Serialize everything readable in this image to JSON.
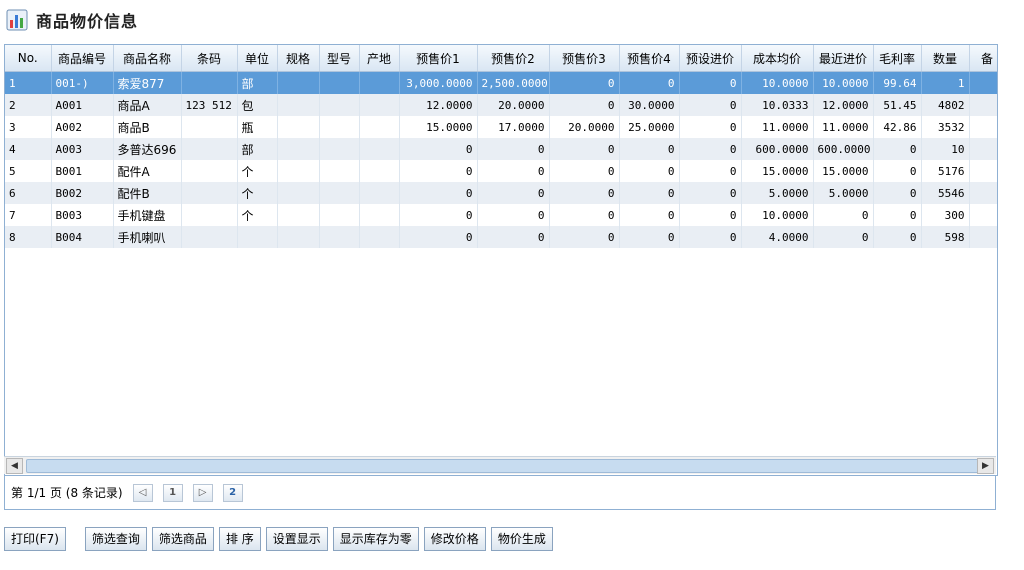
{
  "page": {
    "title": "商品物价信息"
  },
  "columns": [
    "No.",
    "商品编号",
    "商品名称",
    "条码",
    "单位",
    "规格",
    "型号",
    "产地",
    "预售价1",
    "预售价2",
    "预售价3",
    "预售价4",
    "预设进价",
    "成本均价",
    "最近进价",
    "毛利率",
    "数量",
    "备"
  ],
  "rows": [
    [
      "1",
      "001-)",
      "索爱877",
      "",
      "部",
      "",
      "",
      "",
      "3,000.0000",
      "2,500.0000",
      "0",
      "0",
      "0",
      "10.0000",
      "10.0000",
      "99.64",
      "1",
      ""
    ],
    [
      "2",
      "A001",
      "商品A",
      "123 512",
      "包",
      "",
      "",
      "",
      "12.0000",
      "20.0000",
      "0",
      "30.0000",
      "0",
      "10.0333",
      "12.0000",
      "51.45",
      "4802",
      ""
    ],
    [
      "3",
      "A002",
      "商品B",
      "",
      "瓶",
      "",
      "",
      "",
      "15.0000",
      "17.0000",
      "20.0000",
      "25.0000",
      "0",
      "11.0000",
      "11.0000",
      "42.86",
      "3532",
      ""
    ],
    [
      "4",
      "A003",
      "多普达696",
      "",
      "部",
      "",
      "",
      "",
      "0",
      "0",
      "0",
      "0",
      "0",
      "600.0000",
      "600.0000",
      "0",
      "10",
      ""
    ],
    [
      "5",
      "B001",
      "配件A",
      "",
      "个",
      "",
      "",
      "",
      "0",
      "0",
      "0",
      "0",
      "0",
      "15.0000",
      "15.0000",
      "0",
      "5176",
      ""
    ],
    [
      "6",
      "B002",
      "配件B",
      "",
      "个",
      "",
      "",
      "",
      "0",
      "0",
      "0",
      "0",
      "0",
      "5.0000",
      "5.0000",
      "0",
      "5546",
      ""
    ],
    [
      "7",
      "B003",
      "手机键盘",
      "",
      "个",
      "",
      "",
      "",
      "0",
      "0",
      "0",
      "0",
      "0",
      "10.0000",
      "0",
      "0",
      "300",
      ""
    ],
    [
      "8",
      "B004",
      "手机喇叭",
      "",
      "",
      "",
      "",
      "",
      "0",
      "0",
      "0",
      "0",
      "0",
      "4.0000",
      "0",
      "0",
      "598",
      ""
    ]
  ],
  "selected_row": 0,
  "pager": {
    "info": "第 1/1 页 (8 条记录)",
    "page_1": "1",
    "page_2": "2"
  },
  "toolbar": {
    "print": "打印(F7)",
    "filter_query": "筛选查询",
    "filter_goods": "筛选商品",
    "sort": "排 序",
    "display_settings": "设置显示",
    "show_zero_stock": "显示库存为零",
    "modify_price": "修改价格",
    "generate_price": "物价生成"
  },
  "colors": {
    "header_blue": "#d9e6f3",
    "selected": "#5b9bd8",
    "border": "#8fb0d3"
  }
}
